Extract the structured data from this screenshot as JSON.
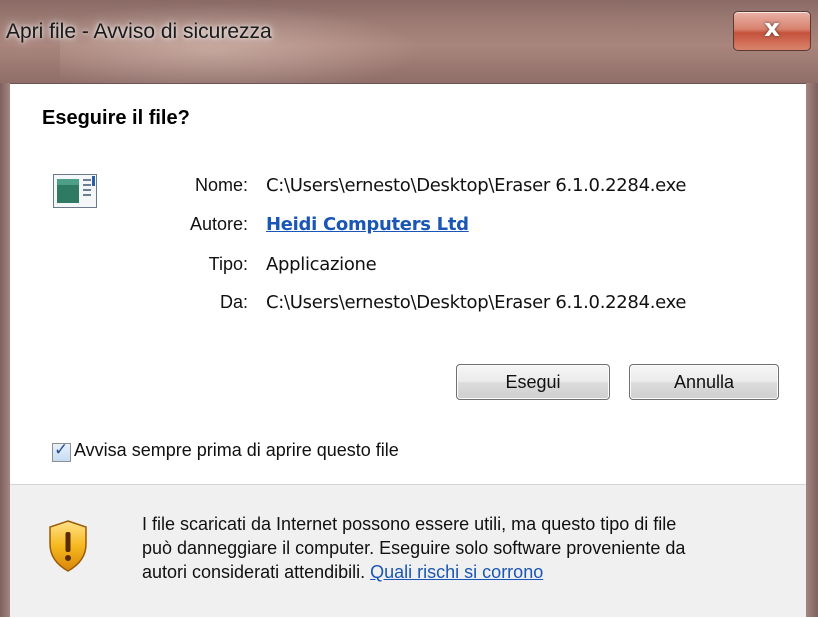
{
  "window": {
    "title": "Apri file - Avviso di sicurezza",
    "close_glyph": "x"
  },
  "dialog": {
    "heading": "Eseguire il file?",
    "fields": {
      "name_label": "Nome:",
      "name_value": "C:\\Users\\ernesto\\Desktop\\Eraser 6.1.0.2284.exe",
      "author_label": "Autore:",
      "author_value": "Heidi Computers Ltd",
      "type_label": "Tipo:",
      "type_value": "Applicazione",
      "from_label": "Da:",
      "from_value": "C:\\Users\\ernesto\\Desktop\\Eraser 6.1.0.2284.exe"
    },
    "buttons": {
      "run": "Esegui",
      "cancel": "Annulla"
    },
    "checkbox": {
      "label": "Avvisa sempre prima di aprire questo file",
      "checked": true
    },
    "warning": {
      "line1": "I file scaricati da Internet possono essere utili, ma questo tipo di file",
      "line2": "può danneggiare il computer. Eseguire solo software proveniente da",
      "line3": "autori considerati attendibili.",
      "link": "Quali rischi si corrono"
    }
  },
  "icons": {
    "file": "application-file-icon",
    "warning": "shield-warning-icon"
  },
  "colors": {
    "link": "#1a56b5",
    "titlebar": "#9b7a73",
    "bottom_panel": "#f0f0f0"
  }
}
